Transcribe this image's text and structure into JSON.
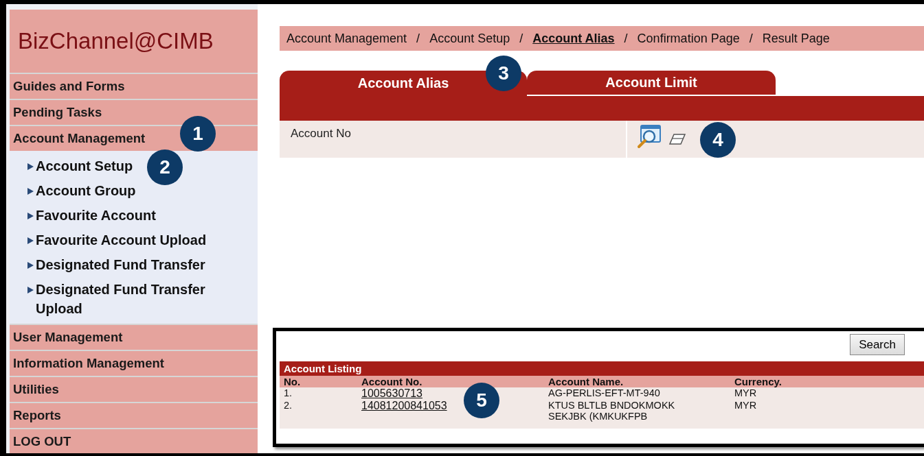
{
  "logo": "BizChannel@CIMB",
  "menu": [
    {
      "label": "Guides and Forms"
    },
    {
      "label": "Pending Tasks"
    },
    {
      "label": "Account Management",
      "callout": "1",
      "children": [
        {
          "label": "Account Setup",
          "callout": "2"
        },
        {
          "label": "Account Group"
        },
        {
          "label": "Favourite Account"
        },
        {
          "label": "Favourite Account Upload"
        },
        {
          "label": "Designated Fund Transfer"
        },
        {
          "label": "Designated Fund Transfer Upload"
        }
      ]
    },
    {
      "label": "User Management"
    },
    {
      "label": "Information Management"
    },
    {
      "label": "Utilities"
    },
    {
      "label": "Reports"
    },
    {
      "label": "LOG OUT"
    }
  ],
  "breadcrumb": [
    {
      "label": "Account Management",
      "selected": false,
      "separator": "/"
    },
    {
      "label": "Account Setup",
      "selected": false,
      "separator": "/"
    },
    {
      "label": "Account Alias",
      "selected": true,
      "separator": "/"
    },
    {
      "label": "Confirmation Page",
      "selected": false,
      "separator": "/"
    },
    {
      "label": "Result Page",
      "selected": false
    }
  ],
  "tabs": [
    {
      "label": "Account Alias",
      "selected": true,
      "callout": "3"
    },
    {
      "label": "Account Limit",
      "selected": false
    }
  ],
  "form": {
    "label": "Account No",
    "callout": "4"
  },
  "listing": {
    "search_button": "Search",
    "title": "Account Listing",
    "callout": "5",
    "columns": [
      "No.",
      "Account No.",
      "Account Name.",
      "Currency."
    ],
    "rows": [
      {
        "no": "1.",
        "account_no": "1005630713",
        "name": "AG-PERLIS-EFT-MT-940",
        "currency": "MYR"
      },
      {
        "no": "2.",
        "account_no": "14081200841053",
        "name": "KTUS BLTLB BNDOKMOKK SEKJBK (KMKUKFPB",
        "currency": "MYR"
      }
    ]
  }
}
